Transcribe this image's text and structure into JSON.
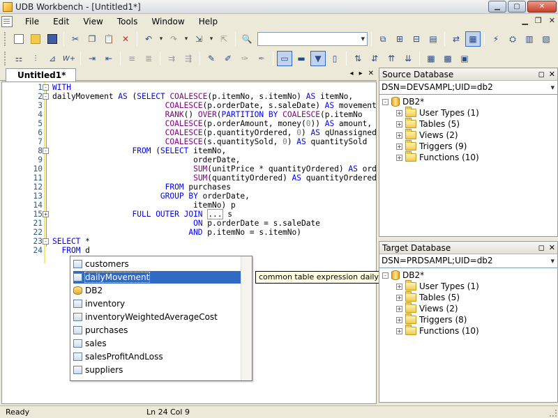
{
  "window": {
    "title": "UDB Workbench - [Untitled1*]"
  },
  "menu": [
    "File",
    "Edit",
    "View",
    "Tools",
    "Window",
    "Help"
  ],
  "editor": {
    "tab_label": "Untitled1*",
    "lines": [
      {
        "n": "1",
        "fold": "-",
        "html": "<span class=\"kw\">WITH</span>"
      },
      {
        "n": "2",
        "fold": "-",
        "html": "dailyMovement <span class=\"kw\">AS</span> (<span class=\"kw\">SELECT</span> <span class=\"fn\">COALESCE</span>(p.itemNo, s.itemNo) <span class=\"kw\">AS</span> itemNo,"
      },
      {
        "n": "3",
        "fold": "",
        "html": "                        <span class=\"fn\">COALESCE</span>(p.orderDate, s.saleDate) <span class=\"kw\">AS</span> movementDate,"
      },
      {
        "n": "4",
        "fold": "",
        "html": "                        <span class=\"fn\">RANK</span>() <span class=\"fn\">OVER</span>(<span class=\"kw\">PARTITION BY</span> <span class=\"fn\">COALESCE</span>(p.itemNo"
      },
      {
        "n": "5",
        "fold": "",
        "html": "                        <span class=\"fn\">COALESCE</span>(p.orderAmount, money(<span class=\"num\">0</span>)) <span class=\"kw\">AS</span> amount,"
      },
      {
        "n": "6",
        "fold": "",
        "html": "                        <span class=\"fn\">COALESCE</span>(p.quantityOrdered, <span class=\"num\">0</span>) <span class=\"kw\">AS</span> qUnassigned,"
      },
      {
        "n": "7",
        "fold": "",
        "html": "                        <span class=\"fn\">COALESCE</span>(s.quantitySold, <span class=\"num\">0</span>) <span class=\"kw\">AS</span> quantitySold"
      },
      {
        "n": "8",
        "fold": "-",
        "html": "                 <span class=\"kw\">FROM</span> (<span class=\"kw\">SELECT</span> itemNo,"
      },
      {
        "n": "9",
        "fold": "",
        "html": "                              orderDate,"
      },
      {
        "n": "10",
        "fold": "",
        "html": "                              <span class=\"fn\">SUM</span>(unitPrice * quantityOrdered) <span class=\"kw\">AS</span> orderAmount,"
      },
      {
        "n": "11",
        "fold": "",
        "html": "                              <span class=\"fn\">SUM</span>(quantityOrdered) <span class=\"kw\">AS</span> quantityOrdered"
      },
      {
        "n": "12",
        "fold": "",
        "html": "                        <span class=\"kw\">FROM</span> purchases"
      },
      {
        "n": "13",
        "fold": "",
        "html": "                       <span class=\"kw\">GROUP BY</span> orderDate,"
      },
      {
        "n": "14",
        "fold": "",
        "html": "                              itemNo) p"
      },
      {
        "n": "15",
        "fold": "+",
        "html": "                 <span class=\"kw\">FULL OUTER JOIN</span> <span style=\"border:1px solid #999\">...</span> s"
      },
      {
        "n": "21",
        "fold": "",
        "html": "                              <span class=\"kw\">ON</span> p.orderDate = s.saleDate"
      },
      {
        "n": "22",
        "fold": "",
        "html": "                             <span class=\"kw\">AND</span> p.itemNo = s.itemNo)"
      },
      {
        "n": "23",
        "fold": "-",
        "html": "<span class=\"kw\">SELECT</span> *"
      },
      {
        "n": "24",
        "fold": "",
        "html": "  <span class=\"kw\">FROM</span> d"
      }
    ]
  },
  "completion": {
    "items": [
      {
        "label": "customers",
        "icon": "table-icon"
      },
      {
        "label": "dailyMovement",
        "icon": "cte-icon",
        "selected": true
      },
      {
        "label": "DB2",
        "icon": "database-icon"
      },
      {
        "label": "inventory",
        "icon": "table-icon"
      },
      {
        "label": "inventoryWeightedAverageCost",
        "icon": "view-icon"
      },
      {
        "label": "purchases",
        "icon": "table-icon"
      },
      {
        "label": "sales",
        "icon": "table-icon"
      },
      {
        "label": "salesProfitAndLoss",
        "icon": "view-icon"
      },
      {
        "label": "suppliers",
        "icon": "table-icon"
      }
    ],
    "tooltip": "common table expression dailyMovement"
  },
  "source_panel": {
    "title": "Source Database",
    "dsn": "DSN=DEVSAMPL;UID=db2",
    "root": "DB2*",
    "children": [
      "User Types (1)",
      "Tables (5)",
      "Views (2)",
      "Triggers (9)",
      "Functions (10)"
    ]
  },
  "target_panel": {
    "title": "Target Database",
    "dsn": "DSN=PRDSAMPL;UID=db2",
    "root": "DB2*",
    "children": [
      "User Types (1)",
      "Tables (5)",
      "Views (2)",
      "Triggers (8)",
      "Functions (10)"
    ]
  },
  "status": {
    "ready": "Ready",
    "ln": "Ln 24",
    "col": "Col 9"
  }
}
